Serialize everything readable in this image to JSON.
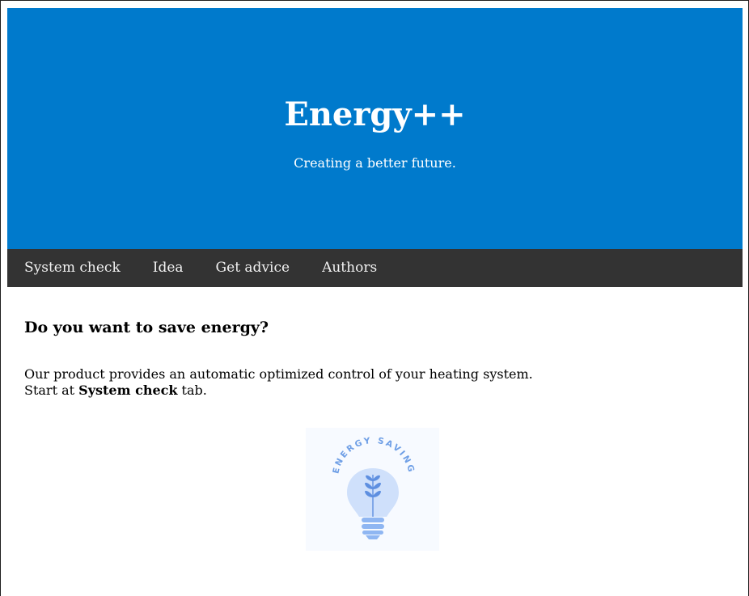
{
  "hero": {
    "title": "Energy++",
    "subtitle": "Creating a better future.",
    "background_color": "#007acc"
  },
  "nav": {
    "background_color": "#333333",
    "items": [
      {
        "label": "System check"
      },
      {
        "label": "Idea"
      },
      {
        "label": "Get advice"
      },
      {
        "label": "Authors"
      }
    ]
  },
  "main": {
    "question": "Do you want to save energy?",
    "intro_line1": "Our product provides an automatic optimized control of your heating system.",
    "intro_line2_prefix": "Start at ",
    "intro_line2_bold": "System check",
    "intro_line2_suffix": " tab."
  },
  "logo": {
    "text": "ENERGY SAVING",
    "icon": "lightbulb-leaf-icon"
  }
}
